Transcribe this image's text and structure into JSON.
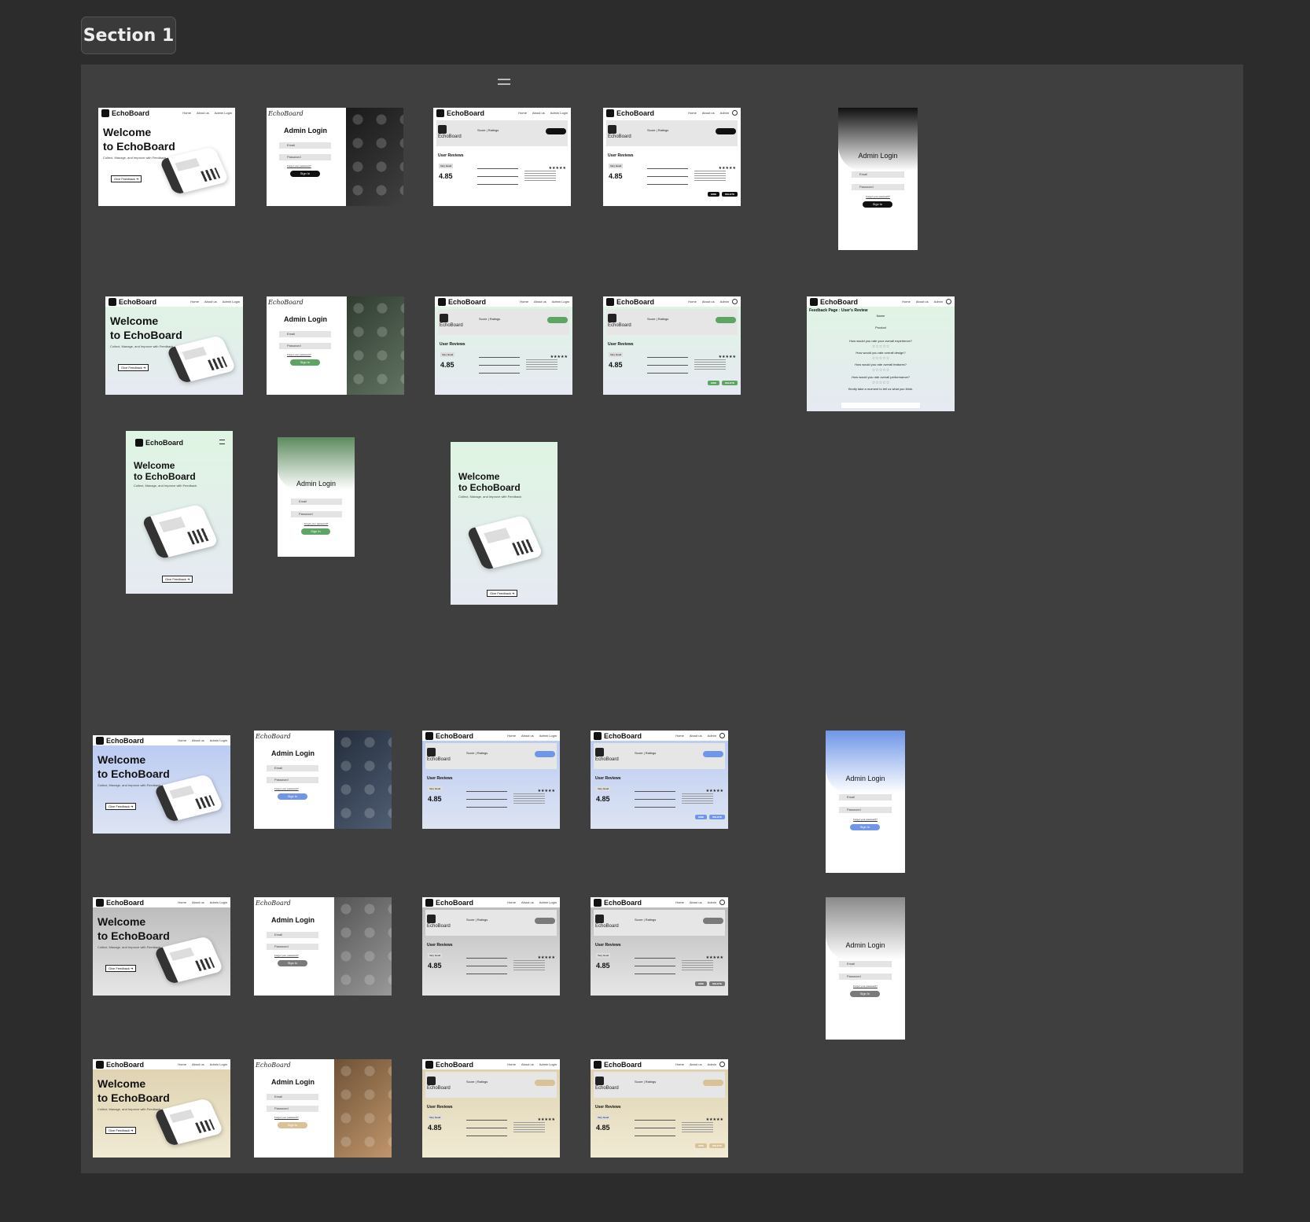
{
  "section": {
    "label": "Section 1"
  },
  "brand": {
    "name": "EchoBoard",
    "script_name": "EchoBoard"
  },
  "nav": {
    "home": "Home",
    "about": "About us",
    "admin_login": "Admin Login",
    "admin": "Admin"
  },
  "hero": {
    "line1": "Welcome",
    "line2": "to EchoBoard",
    "subtitle": "Collect, Manage, and Improve with Feedback",
    "cta": "Give Feedback ➔"
  },
  "login": {
    "title": "Admin Login",
    "email_placeholder": "Email",
    "password_placeholder": "Password",
    "forgot": "Forgot your password?",
    "signin": "Sign In"
  },
  "dashboard": {
    "name": "EchoBoard",
    "score_label": "Score",
    "ratings_label": "Ratings",
    "user_reviews": "User Reviews",
    "very_good": "Very Good",
    "rating": "4.85",
    "stars": "★★★★★",
    "hide": "HIDE",
    "delete": "DELETE"
  },
  "feedback": {
    "title": "Feedback Page : User's Review",
    "name_label": "Name",
    "product_label": "Product",
    "questions": [
      "How would you rate your overall experience?",
      "How would you rate overall design?",
      "How would you rate overall features?",
      "How would you rate overall performance?",
      "Kindly take a moment to tell us what you think."
    ],
    "stars": "☆☆☆☆☆"
  },
  "themes": {
    "black": "#111111",
    "green": "#5ea463",
    "blue": "#6f96e8",
    "gray": "#7a7a7a",
    "beige": "#d9c396"
  }
}
